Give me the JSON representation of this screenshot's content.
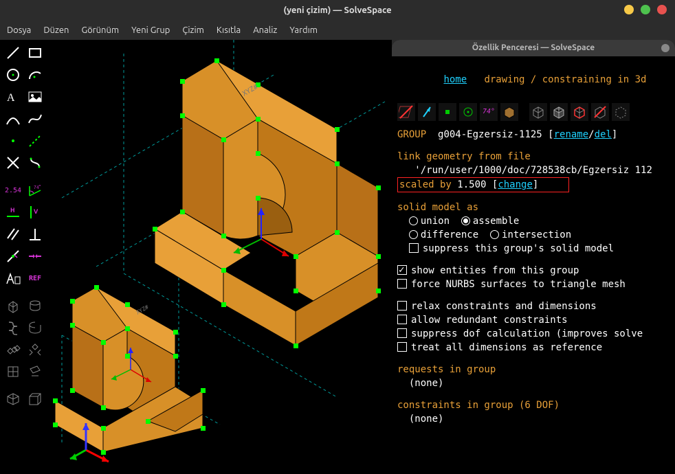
{
  "window": {
    "title": "(yeni çizim) — SolveSpace"
  },
  "menu": {
    "file": "Dosya",
    "edit": "Düzen",
    "view": "Görünüm",
    "newgroup": "Yeni Grup",
    "sketch": "Çizim",
    "constrain": "Kısıtla",
    "analyze": "Analiz",
    "help": "Yardım"
  },
  "toolbar": {
    "line": "line",
    "rect": "rect",
    "circle": "circle",
    "arc": "arc",
    "text": "text",
    "image": "image",
    "tangent_arc": "tangent-arc",
    "bezier": "bezier",
    "point": "point",
    "construction": "construction",
    "split": "split",
    "trim": "trim",
    "dist": "2.54",
    "angle_label": "74°",
    "horiz": "H",
    "vert": "V",
    "parallel": "parallel",
    "perp": "perp",
    "pointon": "pointon",
    "symmetric": "symmetric",
    "equal": "equal",
    "ref_label": "REF",
    "extrude": "extrude",
    "lathe": "lathe",
    "helix": "helix",
    "revolve": "revolve",
    "step_trans": "step-translate",
    "step_rot": "step-rotate",
    "sketch_in_3d": "sketch-in-3d",
    "sketch_in_plane": "sketch-in-plane",
    "nearest_iso": "nearest-iso",
    "nearest_ortho": "nearest-ortho"
  },
  "panel": {
    "title": "Özellik Penceresi — SolveSpace",
    "home": "home",
    "breadcrumb": "drawing / constraining in 3d",
    "group_label": "GROUP",
    "group_name": "g004-Egzersiz-1125",
    "rename": "rename",
    "del": "del",
    "link_geom": "link geometry from file",
    "file_path": "'/run/user/1000/doc/728538cb/Egzersiz 112",
    "scaled_by": "scaled by",
    "scale_value": "1.500",
    "change": "change",
    "solid_model_as": "solid model as",
    "union": "union",
    "assemble": "assemble",
    "difference": "difference",
    "intersection": "intersection",
    "suppress_solid": "suppress this group's solid model",
    "show_entities": "show entities from this group",
    "force_nurbs": "force NURBS surfaces to triangle mesh",
    "relax_constraints": "relax constraints and dimensions",
    "allow_redundant": "allow redundant constraints",
    "suppress_dof": "suppress dof calculation (improves solve",
    "treat_ref": "treat all dimensions as reference",
    "requests": "requests in group",
    "none1": "(none)",
    "constraints": "constraints in group (6 DOF)",
    "none2": "(none)",
    "angle_icon": "74°"
  }
}
